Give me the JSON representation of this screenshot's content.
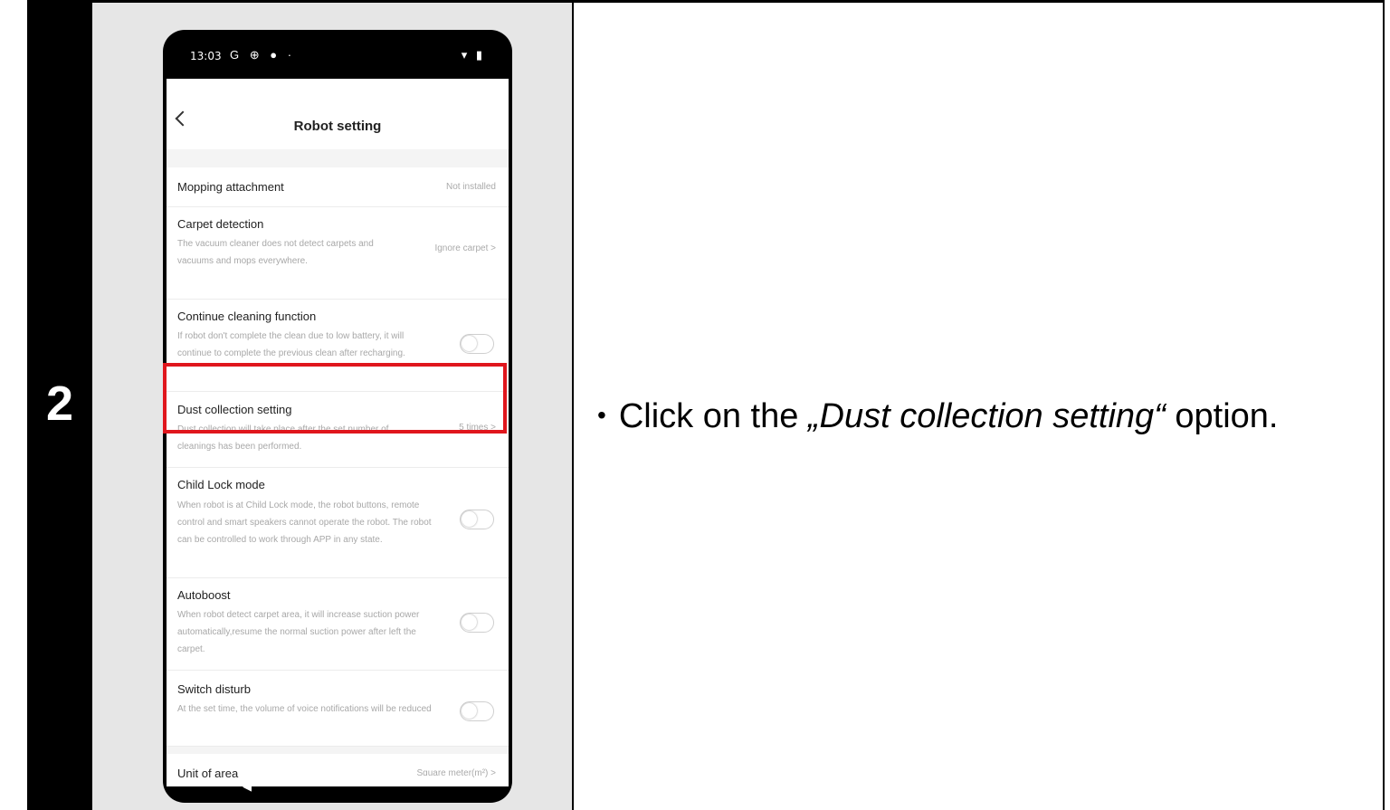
{
  "step": {
    "number": "2"
  },
  "instruction": {
    "bullet": "•",
    "prefix": "Click on the ",
    "emphasis": "„Dust collection setting“",
    "suffix": " option."
  },
  "phone": {
    "status": {
      "time": "13:03",
      "left_icons": "G ⊕ ● ·",
      "right_icons": "▾ ▮"
    },
    "appbar": {
      "title": "Robot setting"
    },
    "rows": [
      {
        "title": "Mopping attachment",
        "value": "Not installed"
      },
      {
        "title": "Carpet detection",
        "desc": "The vacuum cleaner does not detect carpets and vacuums and mops everywhere.",
        "value": "Ignore carpet >"
      },
      {
        "title": "Continue cleaning function",
        "desc": "If robot don't complete the clean due to low battery, it will continue to complete the previous clean after recharging."
      },
      {
        "title": "Dust collection setting",
        "desc": "Dust collection will take place after the set number of cleanings has been performed.",
        "value": "5 times >"
      },
      {
        "title": "Child Lock mode",
        "desc": "When robot is at Child Lock mode, the robot buttons, remote control and smart speakers cannot operate the robot. The robot can be controlled to work through APP in any state."
      },
      {
        "title": "Autoboost",
        "desc": "When robot detect carpet area, it will increase suction power automatically,resume the normal suction power after left the carpet."
      },
      {
        "title": "Switch disturb",
        "desc": "At the set time, the volume of voice notifications will be reduced"
      },
      {
        "title": "Unit of area",
        "value": "Square meter(m²) >"
      }
    ],
    "nav": {
      "back": "◀"
    }
  },
  "colors": {
    "highlight": "#e0161d",
    "step_bg": "#000000",
    "shot_bg": "#e6e6e6"
  }
}
